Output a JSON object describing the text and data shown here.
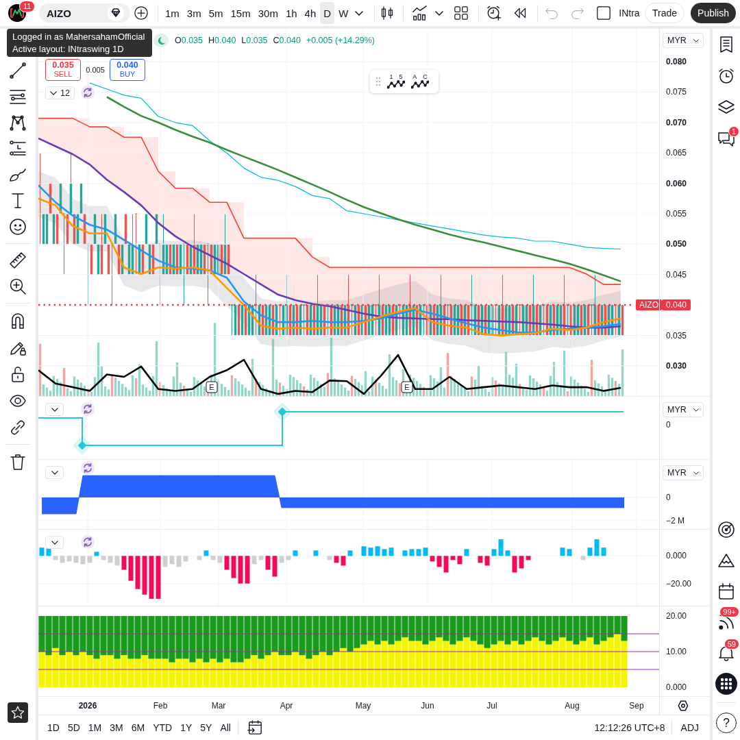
{
  "top_bar": {
    "badge": "11",
    "symbol": "AIZO",
    "intervals": [
      {
        "label": "1m",
        "selected": false
      },
      {
        "label": "3m",
        "selected": false
      },
      {
        "label": "5m",
        "selected": false
      },
      {
        "label": "15m",
        "selected": false
      },
      {
        "label": "30m",
        "selected": false
      },
      {
        "label": "1h",
        "selected": false
      },
      {
        "label": "4h",
        "selected": false
      },
      {
        "label": "D",
        "selected": true
      },
      {
        "label": "W",
        "selected": false
      }
    ],
    "undo": {
      "disabled": true
    },
    "redo": {
      "disabled": true
    },
    "layout_name": "INtra",
    "trade": "Trade",
    "publish": "Publish"
  },
  "tooltip": {
    "lines": [
      "Logged in as MahersahamOfficial",
      "Active layout: INtraswing 1D"
    ]
  },
  "main_chart": {
    "legend": {
      "ohlc": [
        {
          "label": "O",
          "value": "0.035"
        },
        {
          "label": "H",
          "value": "0.040"
        },
        {
          "label": "L",
          "value": "0.035"
        },
        {
          "label": "C",
          "value": "0.040"
        }
      ],
      "change": "+0.005 (+14.29%)"
    },
    "order_panel": {
      "sell": {
        "price": "0.035",
        "label": "SELL"
      },
      "spread": "0.005",
      "buy": {
        "price": "0.040",
        "label": "BUY"
      }
    },
    "indicators_count": "12",
    "drawing_toolbar": [
      {
        "marks": [
          "1",
          "5"
        ]
      },
      {
        "marks": [
          "A",
          "C"
        ]
      }
    ],
    "currency": "MYR",
    "price_tag": {
      "symbol": "AIZO",
      "price": "0.040"
    },
    "events": [
      {
        "label": "E"
      },
      {
        "label": "E"
      }
    ],
    "chart_data": {
      "type": "line",
      "grid": true,
      "ylim": [
        0.02505,
        0.08541
      ],
      "yticks": [
        {
          "value": 0.08,
          "label": "0.080"
        },
        {
          "value": 0.075,
          "label": "0.075"
        },
        {
          "value": 0.07,
          "label": "0.070"
        },
        {
          "value": 0.065,
          "label": "0.065"
        },
        {
          "value": 0.06,
          "label": "0.060"
        },
        {
          "value": 0.055,
          "label": "0.055"
        },
        {
          "value": 0.05,
          "label": "0.050"
        },
        {
          "value": 0.045,
          "label": "0.045"
        },
        {
          "value": 0.035,
          "label": "0.035"
        },
        {
          "value": 0.03,
          "label": "0.030"
        }
      ],
      "categories": [
        null,
        null,
        null,
        null,
        null,
        null,
        null,
        null,
        null,
        null,
        null,
        null,
        null,
        null,
        null,
        null,
        null,
        null,
        null,
        null,
        null,
        null,
        null,
        null,
        null,
        null,
        null,
        null,
        null,
        null,
        null,
        null,
        null,
        null,
        null
      ],
      "series": [
        {
          "color": "#f44336",
          "values": [
            0.0707,
            0.0707,
            0.0707,
            0.0693,
            0.0693,
            0.0676,
            0.0676,
            0.062,
            0.0592,
            0.0592,
            0.0569,
            0.0569,
            0.051,
            0.051,
            0.051,
            0.051,
            0.0479,
            0.0462,
            0.0462,
            0.0462,
            0.0462,
            0.0462,
            0.0462,
            0.0462,
            0.0462,
            0.0462,
            0.0462,
            0.0462,
            0.0462,
            0.0462,
            0.0462,
            0.0462,
            0.0451,
            0.0434,
            0.0434
          ]
        },
        {
          "color": "#673ab7",
          "values": [
            0.0674,
            0.0661,
            0.0648,
            0.0631,
            0.0606,
            0.0586,
            0.0564,
            0.0535,
            0.0513,
            0.0496,
            0.0482,
            0.0468,
            0.0451,
            0.0434,
            0.0417,
            0.0408,
            0.0402,
            0.0398,
            0.0392,
            0.0386,
            0.0381,
            0.0379,
            0.0378,
            0.0377,
            0.0377,
            0.0375,
            0.0374,
            0.0373,
            0.0372,
            0.037,
            0.0368,
            0.0365,
            0.0363,
            0.0363,
            0.0365
          ]
        },
        {
          "color": "#00bcd4",
          "values": [
            null,
            null,
            null,
            0.0765,
            0.0755,
            0.0745,
            0.074,
            0.071,
            0.07,
            0.0695,
            0.067,
            0.065,
            0.0625,
            0.061,
            0.0605,
            0.0595,
            0.058,
            0.0575,
            0.0555,
            0.055,
            0.0545,
            0.054,
            0.0535,
            0.053,
            0.0525,
            0.052,
            0.0515,
            0.0512,
            0.051,
            0.0505,
            0.0505,
            0.05,
            0.0495,
            0.0493,
            0.0492
          ]
        },
        {
          "color": "#388e3c",
          "values": [
            null,
            null,
            null,
            null,
            0.0742,
            0.0726,
            0.0711,
            0.07,
            0.0688,
            0.0677,
            0.0667,
            0.0655,
            0.0644,
            0.0633,
            0.0622,
            0.061,
            0.0598,
            0.0586,
            0.0573,
            0.0561,
            0.0551,
            0.0541,
            0.0532,
            0.0524,
            0.0516,
            0.0509,
            0.0503,
            0.0496,
            0.0489,
            0.0482,
            0.0475,
            0.0468,
            0.0459,
            0.0449,
            0.0439
          ]
        },
        {
          "color": "#2196f3",
          "values": [
            0.0597,
            0.0569,
            0.0547,
            0.0532,
            0.0524,
            0.0507,
            0.049,
            0.0473,
            0.0462,
            0.046,
            0.0457,
            0.0445,
            0.0406,
            0.0383,
            0.0372,
            0.0372,
            0.0374,
            0.0372,
            0.0372,
            0.0374,
            0.0378,
            0.0386,
            0.0392,
            0.0386,
            0.0378,
            0.037,
            0.0363,
            0.0359,
            0.0355,
            0.0355,
            0.0359,
            0.0361,
            0.0363,
            0.0365,
            0.0369
          ]
        },
        {
          "color": "#ff9800",
          "values": [
            0.0575,
            0.0564,
            0.053,
            0.0518,
            0.0518,
            0.0462,
            0.0451,
            0.0462,
            0.046,
            0.0462,
            0.0457,
            0.0428,
            0.04,
            0.0366,
            0.0361,
            0.0363,
            0.0361,
            0.0363,
            0.0363,
            0.0372,
            0.0381,
            0.0389,
            0.0395,
            0.0372,
            0.0366,
            0.0363,
            0.0352,
            0.035,
            0.0352,
            0.0354,
            0.0361,
            0.0359,
            0.0363,
            0.0372,
            0.0378
          ]
        },
        {
          "color": "#000000",
          "values": [
            0.0293,
            0.0271,
            0.0265,
            0.0259,
            0.0286,
            0.0282,
            0.0299,
            0.0262,
            0.0259,
            0.0262,
            0.0282,
            0.0293,
            0.031,
            0.0262,
            0.0254,
            0.0259,
            0.0257,
            0.0276,
            0.0275,
            0.0254,
            0.0284,
            0.0318,
            0.0262,
            0.0262,
            0.0282,
            0.0262,
            0.0265,
            0.0268,
            0.0265,
            0.0262,
            0.0268,
            0.0265,
            0.0265,
            0.0259,
            0.0264
          ]
        }
      ]
    }
  },
  "pane_2": {
    "currency": "MYR",
    "scale_label": "0"
  },
  "pane_3": {
    "currency": "MYR",
    "chart_data": {
      "type": "area",
      "grid": true,
      "ylim": [
        -2.71,
        3.24
      ],
      "yticks": [
        {
          "value": 0,
          "label": "0"
        },
        {
          "value": -2,
          "label": "−2 M"
        }
      ],
      "categories": [
        null,
        null,
        null,
        null,
        null,
        null,
        null,
        null,
        null,
        null,
        null,
        null,
        null,
        null,
        null,
        null,
        null,
        null,
        null,
        null,
        null,
        null,
        null,
        null,
        null,
        null,
        null,
        null,
        null,
        null,
        null,
        null,
        null,
        null,
        null,
        null,
        null,
        null,
        null,
        null,
        null,
        null,
        null,
        null,
        null,
        null,
        null,
        null,
        null,
        null,
        null,
        null,
        null,
        null,
        null,
        null,
        null,
        null,
        null,
        null,
        null,
        null,
        null,
        null,
        null,
        null,
        null,
        null,
        null,
        null,
        null,
        null,
        null,
        null,
        null,
        null,
        null,
        null,
        null,
        null,
        null,
        null,
        null,
        null,
        null,
        null
      ],
      "series": [
        {
          "color": "#2962ff",
          "values": [
            -1.41,
            -1.41,
            -1.41,
            -1.41,
            -1.41,
            -1.41,
            1.88,
            1.88,
            1.88,
            1.88,
            1.88,
            1.88,
            1.88,
            1.88,
            1.88,
            1.88,
            1.88,
            1.88,
            1.88,
            1.88,
            1.88,
            1.88,
            1.88,
            1.88,
            1.88,
            1.88,
            1.88,
            1.88,
            1.88,
            1.88,
            1.88,
            1.88,
            1.88,
            1.88,
            1.88,
            -0.88,
            -0.88,
            -0.88,
            -0.88,
            -0.88,
            -0.88,
            -0.88,
            -0.88,
            -0.88,
            -0.88,
            -0.88,
            -0.88,
            -0.88,
            -0.88,
            -0.88,
            -0.88,
            -0.88,
            -0.88,
            -0.88,
            -0.88,
            -0.88,
            -0.88,
            -0.88,
            -0.88,
            -0.88,
            -0.88,
            -0.88,
            -0.88,
            -0.88,
            -0.88,
            -0.88,
            -0.88,
            -0.88,
            -0.88,
            -0.88,
            -0.88,
            -0.88,
            -0.88,
            -0.88,
            -0.88,
            -0.88,
            -0.88,
            -0.88,
            -0.88,
            -0.88,
            -0.88,
            -0.88,
            -0.88,
            -0.88,
            -0.88,
            -0.88
          ]
        }
      ]
    }
  },
  "pane_4": {
    "chart_data": {
      "type": "bar",
      "grid": true,
      "ylim": [
        -36,
        19
      ],
      "yticks": [
        {
          "value": 0,
          "label": "0.000"
        },
        {
          "value": -20,
          "label": "−20.00"
        }
      ],
      "categories": [
        null,
        null,
        null,
        null,
        null,
        null,
        null,
        null,
        null,
        null,
        null,
        null,
        null,
        null,
        null,
        null,
        null,
        null,
        null,
        null,
        null,
        null,
        null,
        null,
        null,
        null,
        null,
        null,
        null,
        null,
        null,
        null,
        null,
        null,
        null,
        null,
        null,
        null,
        null,
        null,
        null,
        null,
        null,
        null,
        null,
        null,
        null,
        null,
        null,
        null,
        null,
        null,
        null,
        null,
        null,
        null,
        null,
        null,
        null,
        null,
        null,
        null,
        null,
        null,
        null,
        null,
        null,
        null,
        null,
        null,
        null,
        null,
        null,
        null,
        null,
        null,
        null,
        null,
        null,
        null,
        null,
        null,
        null,
        null,
        null,
        null
      ],
      "series": [
        {
          "color": "#00bcf2",
          "values": [
            6,
            6,
            null,
            null,
            null,
            null,
            null,
            null,
            3,
            null,
            null,
            null,
            null,
            null,
            null,
            null,
            null,
            null,
            null,
            null,
            null,
            null,
            null,
            null,
            4,
            null,
            null,
            null,
            null,
            null,
            null,
            null,
            null,
            null,
            null,
            null,
            null,
            4,
            null,
            null,
            4,
            null,
            null,
            null,
            null,
            4,
            null,
            7,
            6,
            7,
            5,
            6,
            null,
            4,
            5,
            5,
            6,
            null,
            null,
            null,
            null,
            null,
            5,
            null,
            null,
            null,
            5,
            12,
            4,
            null,
            null,
            null,
            null,
            null,
            null,
            null,
            6,
            5,
            null,
            null,
            6,
            12,
            6,
            null,
            null,
            null
          ]
        },
        {
          "color": "#cfcfcf",
          "values": [
            null,
            null,
            -3,
            -5,
            -4,
            -5,
            -6,
            -5,
            null,
            -3,
            -5,
            -7,
            null,
            null,
            null,
            null,
            null,
            null,
            -8,
            -6,
            -8,
            -4,
            null,
            -3,
            null,
            -3,
            -5,
            null,
            null,
            null,
            null,
            -6,
            -3,
            null,
            null,
            -5,
            -3,
            null,
            null,
            null,
            null,
            null,
            -3,
            null,
            null,
            null,
            null,
            null,
            null,
            null,
            null,
            null,
            null,
            null,
            null,
            null,
            null,
            null,
            null,
            null,
            null,
            null,
            null,
            null,
            null,
            null,
            null,
            null,
            null,
            null,
            null,
            null,
            null,
            null,
            null,
            null,
            null,
            null,
            null,
            -3,
            null,
            null,
            null,
            null,
            null,
            null
          ]
        },
        {
          "color": "#f50a5a",
          "values": [
            null,
            null,
            null,
            null,
            null,
            null,
            null,
            null,
            null,
            null,
            null,
            null,
            -10,
            -18,
            -24,
            -28,
            -31,
            -31,
            null,
            null,
            null,
            null,
            null,
            null,
            null,
            null,
            null,
            -10,
            -16,
            -20,
            -20,
            null,
            null,
            -10,
            -15,
            null,
            null,
            null,
            null,
            null,
            null,
            null,
            null,
            -5,
            -7,
            null,
            null,
            null,
            null,
            null,
            null,
            null,
            null,
            null,
            null,
            null,
            null,
            -4,
            -8,
            -12,
            -3,
            -6,
            null,
            null,
            -5,
            -7,
            null,
            null,
            null,
            -12,
            -9,
            -3,
            null,
            null,
            null,
            null,
            null,
            null,
            null,
            null,
            null,
            null,
            null,
            null,
            null,
            null
          ]
        }
      ]
    }
  },
  "pane_5": {
    "chart_data": {
      "type": "bar",
      "stacked": true,
      "ylim": [
        0,
        20
      ],
      "yticks": [
        {
          "value": 20,
          "label": "20.00"
        },
        {
          "value": 10,
          "label": "10.00"
        },
        {
          "value": 0,
          "label": "0.000"
        }
      ],
      "categories": [
        null,
        null,
        null,
        null,
        null,
        null,
        null,
        null,
        null,
        null,
        null,
        null,
        null,
        null,
        null,
        null,
        null,
        null,
        null,
        null,
        null,
        null,
        null,
        null,
        null,
        null,
        null,
        null,
        null,
        null,
        null,
        null,
        null,
        null,
        null,
        null,
        null,
        null,
        null,
        null,
        null,
        null,
        null,
        null,
        null,
        null,
        null,
        null,
        null,
        null,
        null,
        null,
        null,
        null,
        null,
        null,
        null,
        null,
        null,
        null,
        null,
        null,
        null,
        null,
        null,
        null,
        null,
        null,
        null,
        null,
        null,
        null,
        null,
        null,
        null,
        null,
        null,
        null,
        null,
        null,
        null,
        null,
        null,
        null,
        null,
        null
      ],
      "series": [
        {
          "color": "#f5f500",
          "values": [
            10,
            9,
            11,
            9,
            10,
            9,
            10,
            9,
            8,
            9,
            9,
            8,
            9,
            8,
            8,
            9,
            8,
            8,
            8,
            7,
            8,
            8,
            7,
            8,
            7,
            8,
            7,
            8,
            7,
            7,
            8,
            9,
            8,
            9,
            10,
            9,
            9,
            10,
            9,
            8,
            9,
            10,
            9,
            10,
            11,
            10,
            11,
            12,
            13,
            12,
            13,
            12,
            13,
            14,
            13,
            13,
            12,
            13,
            14,
            13,
            12,
            13,
            14,
            13,
            12,
            11,
            12,
            13,
            12,
            13,
            12,
            13,
            14,
            13,
            12,
            13,
            14,
            13,
            12,
            13,
            14,
            12,
            13,
            14,
            15,
            13
          ]
        },
        {
          "color": "#1a9a1a",
          "values": [
            10,
            11,
            9,
            11,
            10,
            11,
            10,
            11,
            12,
            11,
            11,
            12,
            11,
            12,
            12,
            11,
            12,
            12,
            12,
            13,
            12,
            12,
            13,
            12,
            13,
            12,
            13,
            12,
            13,
            13,
            12,
            11,
            12,
            11,
            10,
            11,
            11,
            10,
            11,
            12,
            11,
            10,
            11,
            10,
            9,
            10,
            9,
            8,
            7,
            8,
            7,
            8,
            7,
            6,
            7,
            7,
            8,
            7,
            6,
            7,
            8,
            7,
            6,
            7,
            8,
            9,
            8,
            7,
            8,
            7,
            8,
            7,
            6,
            7,
            8,
            7,
            6,
            7,
            8,
            7,
            6,
            8,
            7,
            6,
            5,
            7
          ]
        }
      ]
    }
  },
  "time_axis": [
    {
      "label": "2026",
      "year": true
    },
    {
      "label": "Feb",
      "year": false
    },
    {
      "label": "Mar",
      "year": false
    },
    {
      "label": "Apr",
      "year": false
    },
    {
      "label": "May",
      "year": false
    },
    {
      "label": "Jun",
      "year": false
    },
    {
      "label": "Jul",
      "year": false
    },
    {
      "label": "Aug",
      "year": false
    },
    {
      "label": "Sep",
      "year": false
    }
  ],
  "bottom_bar": {
    "ranges": [
      "1D",
      "5D",
      "1M",
      "3M",
      "6M",
      "YTD",
      "1Y",
      "5Y",
      "All"
    ],
    "clock": "12:12:26 UTC+8",
    "adjust": "ADJ"
  },
  "right_toolbar": {
    "chat_badge": "1",
    "feed_badge": "99+",
    "alerts_badge": "59",
    "help": "?"
  }
}
